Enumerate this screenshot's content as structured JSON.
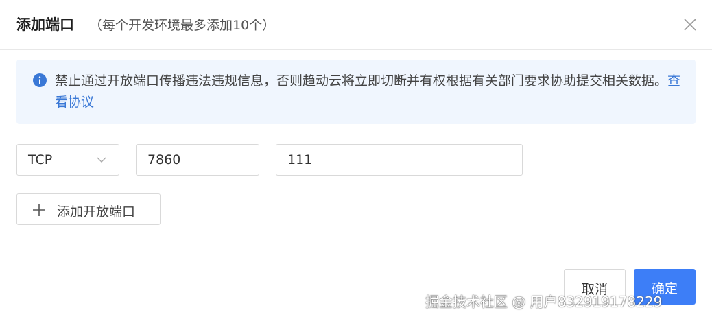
{
  "dialog": {
    "title": "添加端口",
    "subtitle": "（每个开发环境最多添加10个）"
  },
  "notice": {
    "text": "禁止通过开放端口传播违法违规信息，否则趋动云将立即切断并有权根据有关部门要求协助提交相关数据。",
    "link_label": "查看协议",
    "icon": "info-icon",
    "color": "#3a78d6"
  },
  "port_row": {
    "protocol": "TCP",
    "port": "7860",
    "remark": "111"
  },
  "add_button": {
    "label": "添加开放端口"
  },
  "footer": {
    "cancel_label": "取消",
    "confirm_label": "确定",
    "confirm_color": "#3d7ef7"
  },
  "watermark": {
    "text": "掘金技术社区 @ 用户832919178229"
  }
}
